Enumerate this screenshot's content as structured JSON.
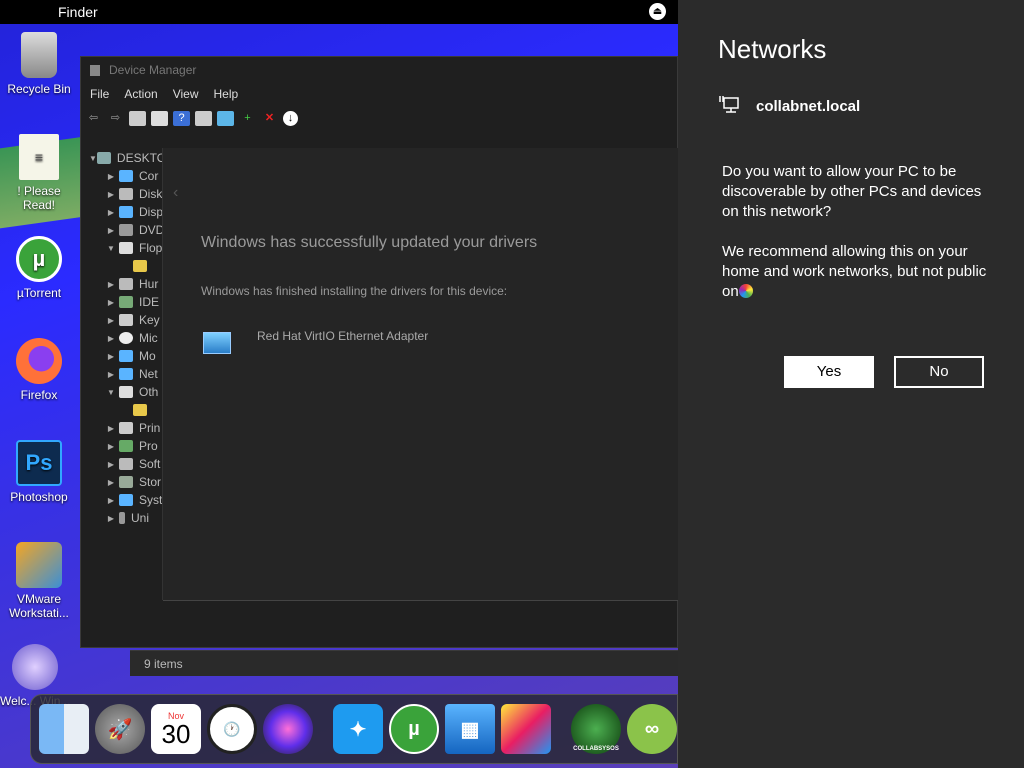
{
  "menubar": {
    "app_name": "Finder"
  },
  "desktop_icons": [
    {
      "label": "Recycle Bin"
    },
    {
      "label": "! Please Read!"
    },
    {
      "label": "µTorrent"
    },
    {
      "label": "Firefox"
    },
    {
      "label": "Photoshop"
    },
    {
      "label": "VMware Workstati..."
    },
    {
      "label": "Welc... Win..."
    }
  ],
  "device_manager": {
    "title": "Device Manager",
    "menu": [
      "File",
      "Action",
      "View",
      "Help"
    ],
    "tree_root": "DESKTO",
    "tree_items": [
      "Cor",
      "Disk",
      "Disp",
      "DVD",
      "Flop",
      "",
      "Hur",
      "IDE",
      "Key",
      "Mic",
      "Mo",
      "Net",
      "Oth",
      "",
      "Prin",
      "Pro",
      "Soft",
      "Stor",
      "Syst",
      "Uni"
    ]
  },
  "driver_dialog": {
    "heading": "Windows has successfully updated your drivers",
    "subheading": "Windows has finished installing the drivers for this device:",
    "device": "Red Hat VirtIO Ethernet Adapter"
  },
  "status_bar": {
    "items": "9 items"
  },
  "dock": {
    "calendar_month": "Nov",
    "calendar_day": "30",
    "collab_label": "COLLABSYSOS"
  },
  "networks_panel": {
    "title": "Networks",
    "network_name": "collabnet.local",
    "question": "Do you want to allow your PC to be discoverable by other PCs and devices on this network?",
    "recommendation": "We recommend allowing this on your home and work networks, but not public on",
    "yes_label": "Yes",
    "no_label": "No"
  }
}
